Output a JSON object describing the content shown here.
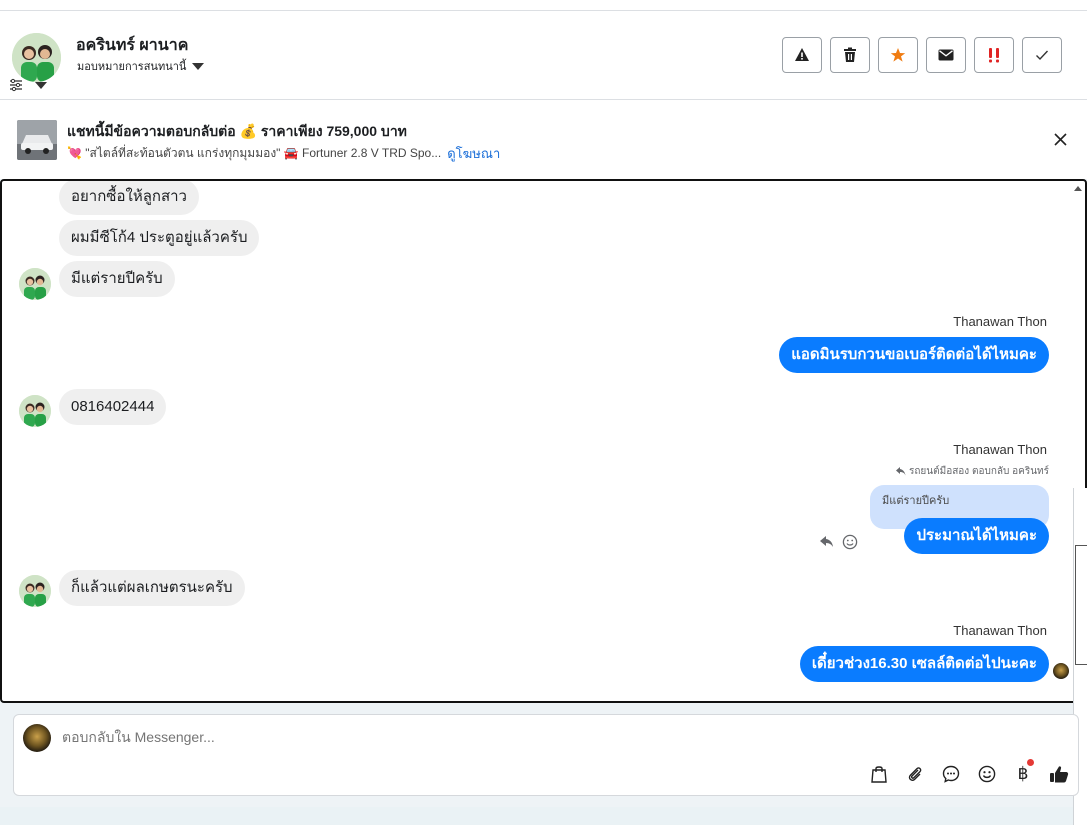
{
  "header": {
    "contact_name": "อครินทร์ ผานาค",
    "assign_label": "มอบหมายการสนทนานี้",
    "actions": [
      {
        "icon": "warning-icon"
      },
      {
        "icon": "trash-icon"
      },
      {
        "icon": "star-icon",
        "color": "#f07c12"
      },
      {
        "icon": "envelope-icon"
      },
      {
        "icon": "urgent-icon",
        "color": "#e02424"
      },
      {
        "icon": "check-icon"
      }
    ]
  },
  "ad": {
    "title": "แชทนี้มีข้อความตอบกลับต่อ 💰 ราคาเพียง 759,000 บาท",
    "subtitle": "💘 \"สไตล์ที่สะท้อนตัวตน แกร่งทุกมุมมอง\" 🚘 Fortuner 2.8 V TRD Spo...",
    "link": "ดูโฆษณา"
  },
  "messages": {
    "in_1": "อยากซื้อให้ลูกสาว",
    "in_2": "ผมมีซีโก้4 ประตูอยู่แล้วครับ",
    "in_3": "มีแต่รายปีครับ",
    "sender_1": "Thanawan Thon",
    "out_1": "แอดมินรบกวนขอเบอร์ติดต่อได้ไหมคะ",
    "in_4": "0816402444",
    "sender_2": "Thanawan Thon",
    "reply_note": "รถยนต์มือสอง ตอบกลับ อครินทร์",
    "quoted": "มีแต่รายปีครับ",
    "out_2": "ประมาณได้ไหมคะ",
    "in_5": "ก็แล้วแต่ผลเกษตรนะครับ",
    "sender_3": "Thanawan Thon",
    "out_3": "เดี๋ยวช่วง16.30 เซลล์ติดต่อไปนะคะ"
  },
  "composer": {
    "placeholder": "ตอบกลับใน Messenger..."
  },
  "colors": {
    "accent_blue": "#0a7cff",
    "incoming_bubble": "#efefef",
    "quoted_bubble": "#cfe1fd",
    "link_blue": "#1a6ed8"
  }
}
